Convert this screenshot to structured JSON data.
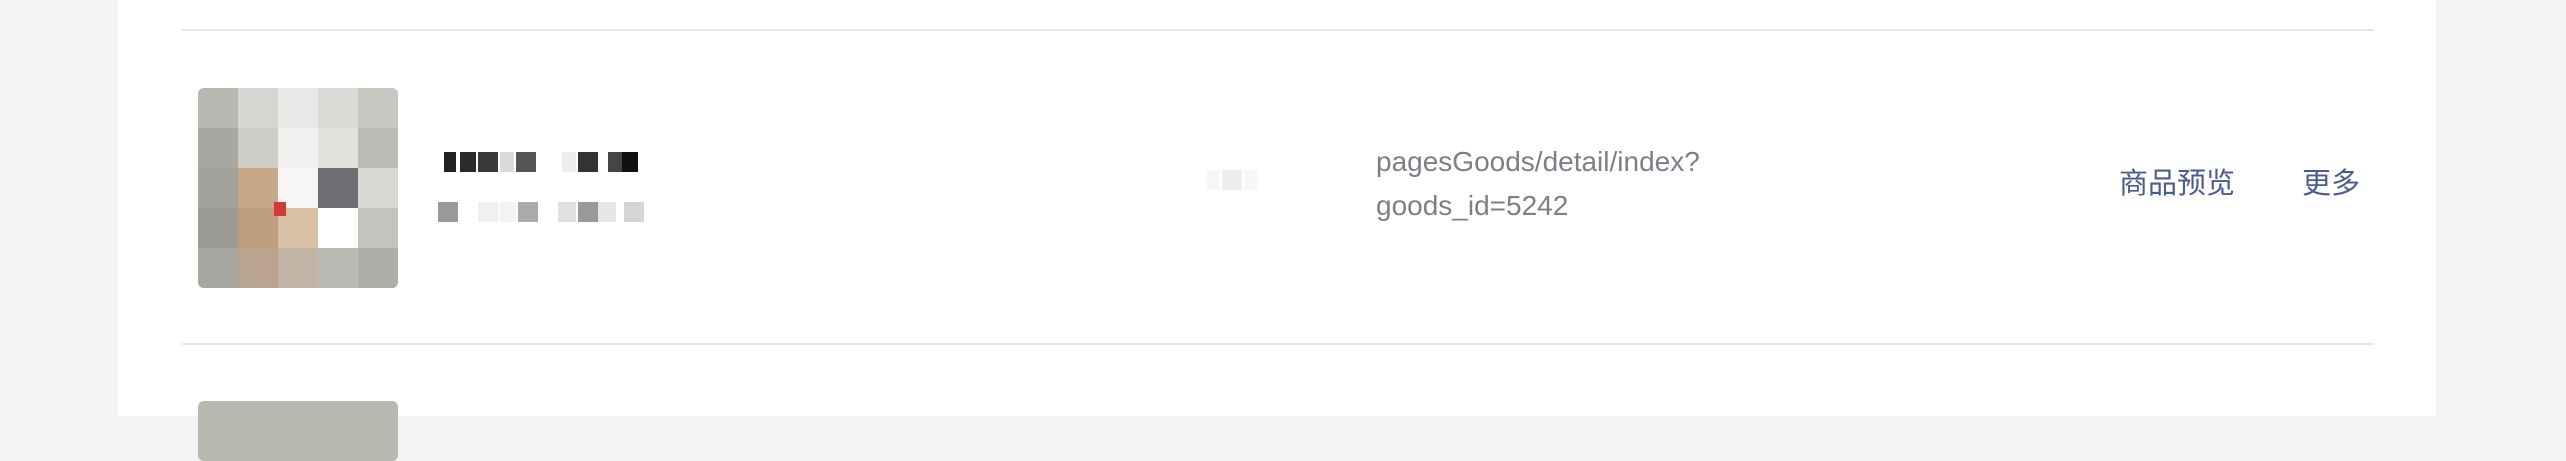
{
  "rows": [
    {
      "page_path": "pagesGoods/detail/index?goods_id=5242",
      "preview_label": "商品预览",
      "more_label": "更多"
    }
  ],
  "colors": {
    "panel_background": "#ffffff",
    "page_background": "#f3f4f6",
    "link": "#4b5c8c",
    "muted_text": "#7b7f88",
    "divider": "#e6e7ea"
  }
}
